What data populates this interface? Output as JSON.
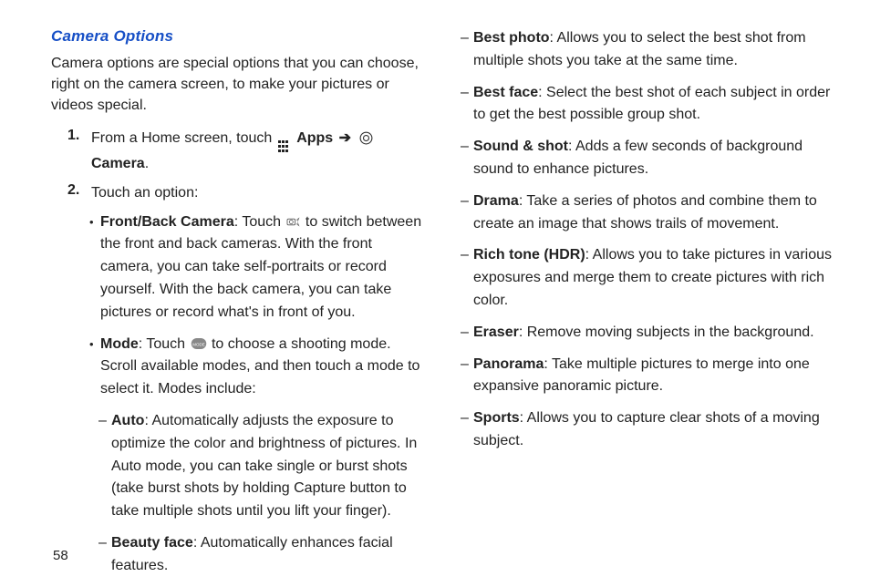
{
  "section_title": "Camera Options",
  "intro": "Camera options are special options that you can choose, right on the camera screen, to make your pictures or videos special.",
  "steps": {
    "s1_num": "1.",
    "s1_pre": "From a Home screen, touch ",
    "s1_apps": "Apps",
    "s1_arrow": "➔",
    "s1_camera": "Camera",
    "s1_end": ".",
    "s2_num": "2.",
    "s2_text": "Touch an option:"
  },
  "bullets": {
    "front_back_label": "Front/Back Camera",
    "front_back_pre": ": Touch ",
    "front_back_rest": " to switch between the front and back cameras. With the front camera, you can take self-portraits or record yourself. With the back camera, you can take pictures or record what's in front of you.",
    "mode_label": "Mode",
    "mode_pre": ": Touch ",
    "mode_rest": " to choose a shooting mode. Scroll available modes, and then touch a mode to select it. Modes include:"
  },
  "modes_left": {
    "auto_label": "Auto",
    "auto_text": ": Automatically adjusts the exposure to optimize the color and brightness of pictures. In Auto mode, you can take single or burst shots (take burst shots by holding Capture button to take multiple shots until you lift your finger).",
    "beauty_label": "Beauty face",
    "beauty_text": ": Automatically enhances facial features."
  },
  "modes_right": {
    "bestphoto_label": "Best photo",
    "bestphoto_text": ": Allows you to select the best shot from multiple shots you take at the same time.",
    "bestface_label": "Best face",
    "bestface_text": ": Select the best shot of each subject in order to get the best possible group shot.",
    "sound_label": "Sound & shot",
    "sound_text": ": Adds a few seconds of background sound to enhance pictures.",
    "drama_label": "Drama",
    "drama_text": ": Take a series of photos and combine them to create an image that shows trails of movement.",
    "rich_label": "Rich tone (HDR)",
    "rich_text": ": Allows you to take pictures in various exposures and merge them to create pictures with rich color.",
    "eraser_label": "Eraser",
    "eraser_text": ": Remove moving subjects in the background.",
    "panorama_label": "Panorama",
    "panorama_text": ": Take multiple pictures to merge into one expansive panoramic picture.",
    "sports_label": "Sports",
    "sports_text": ": Allows you to capture clear shots of a moving subject."
  },
  "page_number": "58"
}
